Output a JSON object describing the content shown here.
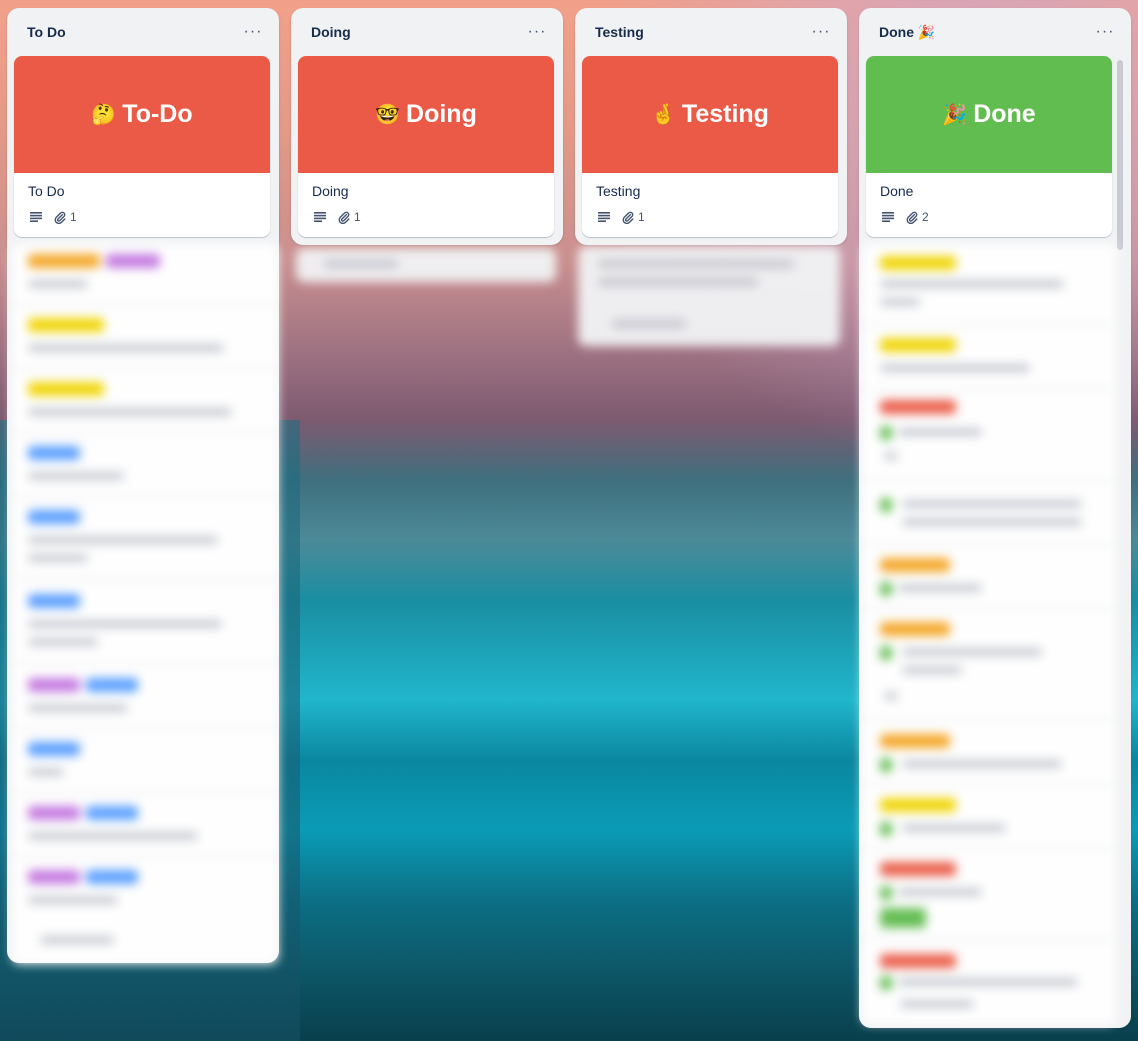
{
  "columns": [
    {
      "title": "To Do",
      "menu_label": "···",
      "card": {
        "cover_emoji": "🤔",
        "cover_text": "To-Do",
        "cover_color": "#eb5a46",
        "title": "To Do",
        "attachments": "1"
      }
    },
    {
      "title": "Doing",
      "menu_label": "···",
      "card": {
        "cover_emoji": "🤓",
        "cover_text": "Doing",
        "cover_color": "#eb5a46",
        "title": "Doing",
        "attachments": "1"
      }
    },
    {
      "title": "Testing",
      "menu_label": "···",
      "card": {
        "cover_emoji": "🤞",
        "cover_text": "Testing",
        "cover_color": "#eb5a46",
        "title": "Testing",
        "attachments": "1"
      }
    },
    {
      "title": "Done 🎉",
      "menu_label": "···",
      "card": {
        "cover_emoji": "🎉",
        "cover_text": "Done",
        "cover_color": "#61bd4f",
        "title": "Done",
        "attachments": "2"
      }
    }
  ],
  "icons": {
    "menu": "more-horizontal-icon",
    "description": "description-lines-icon",
    "attachment": "paperclip-icon"
  },
  "colors": {
    "label_orange": "#f5a623",
    "label_yellow": "#f2d600",
    "label_purple": "#c377e0",
    "label_blue": "#579dff",
    "label_red": "#eb5a46",
    "label_green": "#61bd4f"
  }
}
